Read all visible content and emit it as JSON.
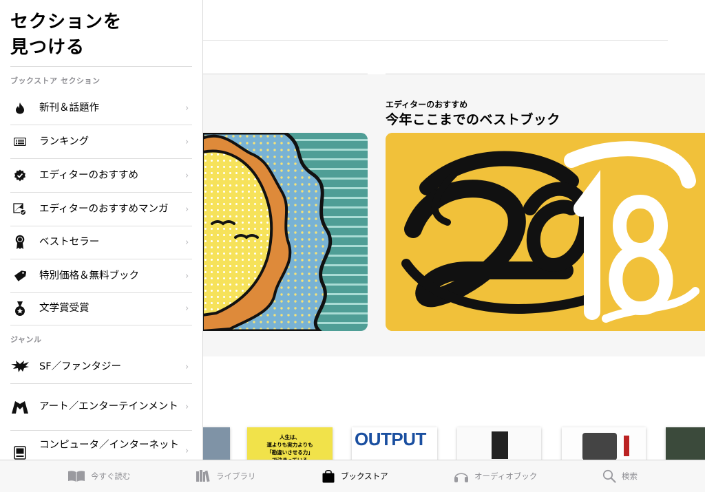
{
  "sidebar": {
    "title_line1": "セクションを",
    "title_line2": "見つける",
    "section_store": "ブックストア セクション",
    "store_items": [
      {
        "label": "新刊＆話題作",
        "icon": "flame-icon"
      },
      {
        "label": "ランキング",
        "icon": "list-icon"
      },
      {
        "label": "エディターのおすすめ",
        "icon": "checkmark-badge-icon"
      },
      {
        "label": "エディターのおすすめマンガ",
        "icon": "manga-badge-icon"
      },
      {
        "label": "ベストセラー",
        "icon": "ribbon-icon"
      },
      {
        "label": "特別価格＆無料ブック",
        "icon": "price-tag-icon"
      },
      {
        "label": "文学賞受賞",
        "icon": "medal-icon"
      }
    ],
    "section_genre": "ジャンル",
    "genre_items": [
      {
        "label": "SF／ファンタジー",
        "icon": "dragon-icon"
      },
      {
        "label": "アート／エンターテインメント",
        "icon": "theater-icon"
      },
      {
        "label": "コンピュータ／インターネット",
        "icon": "computer-icon"
      }
    ]
  },
  "main": {
    "feature_eyebrow": "エディターのおすすめ",
    "feature_title": "今年ここまでのベストブック",
    "book_output_title": "OUTPUT",
    "book_jinsei_text": "人生は、\n運よりも実力よりも\n「勘違いさせる力」\nで決まっている"
  },
  "tabbar": {
    "tabs": [
      {
        "label": "今すぐ読む",
        "icon": "book-open-icon",
        "active": false
      },
      {
        "label": "ライブラリ",
        "icon": "library-icon",
        "active": false
      },
      {
        "label": "ブックストア",
        "icon": "shopping-bag-icon",
        "active": true
      },
      {
        "label": "オーディオブック",
        "icon": "headphones-icon",
        "active": false
      },
      {
        "label": "検索",
        "icon": "search-icon",
        "active": false
      }
    ]
  },
  "colors": {
    "accent_yellow": "#f1c13a",
    "teal_stripes": "#4f9e96",
    "sun_orange": "#de8a3a",
    "active_tab": "#000000",
    "inactive_tab": "#8e8e93"
  }
}
